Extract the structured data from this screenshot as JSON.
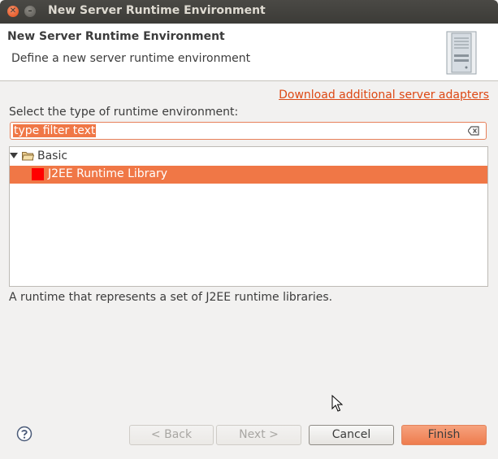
{
  "window": {
    "title": "New Server Runtime Environment"
  },
  "header": {
    "title": "New Server Runtime Environment",
    "description": "Define a new server runtime environment",
    "icon": "server-icon"
  },
  "links": {
    "download": "Download additional server adapters"
  },
  "filter": {
    "label": "Select the type of runtime environment:",
    "placeholder": "type filter text",
    "value": "type filter text"
  },
  "tree": {
    "items": [
      {
        "label": "Basic",
        "expanded": true,
        "icon": "folder-open-icon"
      },
      {
        "label": "J2EE Runtime Library",
        "selected": true,
        "icon": "runtime-library-icon"
      }
    ]
  },
  "description": "A runtime that represents a set of J2EE runtime libraries.",
  "buttons": {
    "back": "< Back",
    "next": "Next >",
    "cancel": "Cancel",
    "finish": "Finish"
  },
  "colors": {
    "accent": "#f07746",
    "link": "#dd4814",
    "title_bar": "#3c3b37"
  }
}
